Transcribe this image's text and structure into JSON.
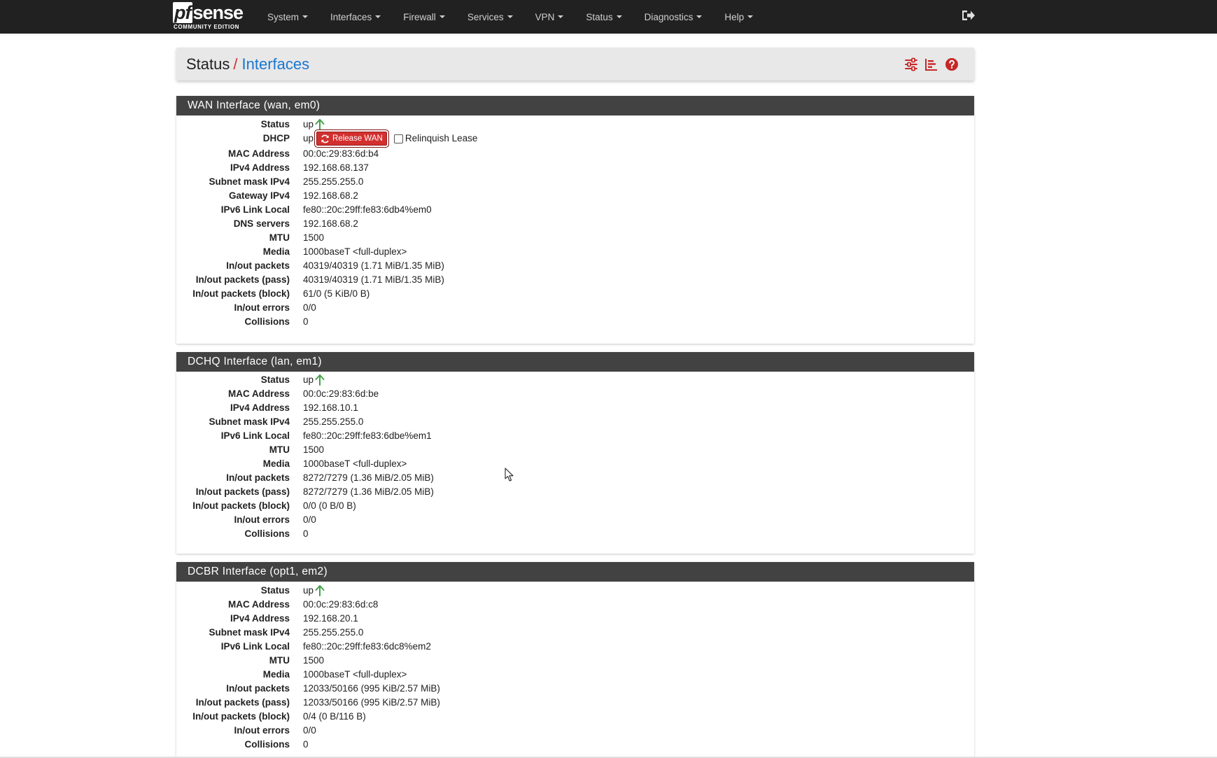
{
  "navbar": {
    "logo_main": "sense",
    "logo_pf": "pf",
    "logo_sub": "COMMUNITY EDITION",
    "menu": [
      {
        "label": "System"
      },
      {
        "label": "Interfaces"
      },
      {
        "label": "Firewall"
      },
      {
        "label": "Services"
      },
      {
        "label": "VPN"
      },
      {
        "label": "Status"
      },
      {
        "label": "Diagnostics"
      },
      {
        "label": "Help"
      }
    ],
    "logout_icon": "sign-out-icon"
  },
  "breadcrumb": {
    "first": "Status",
    "separator": "/",
    "last": "Interfaces",
    "icons": [
      "sliders-icon",
      "bar-chart-icon",
      "help-circle-icon"
    ]
  },
  "colors": {
    "navbar_bg": "#212121",
    "panel_head_bg": "#424242",
    "accent_red": "#d32f2f",
    "link_blue": "#1976d2",
    "status_up_green": "#43a047"
  },
  "interfaces": [
    {
      "title": "WAN Interface (wan, em0)",
      "status": "up",
      "dhcp": {
        "label": "DHCP",
        "value": "up",
        "button": "Release WAN",
        "checkbox_label": "Relinquish Lease",
        "checked": false
      },
      "rows": [
        {
          "label": "MAC Address",
          "value": "00:0c:29:83:6d:b4"
        },
        {
          "label": "IPv4 Address",
          "value": "192.168.68.137"
        },
        {
          "label": "Subnet mask IPv4",
          "value": "255.255.255.0"
        },
        {
          "label": "Gateway IPv4",
          "value": "192.168.68.2"
        },
        {
          "label": "IPv6 Link Local",
          "value": "fe80::20c:29ff:fe83:6db4%em0"
        },
        {
          "label": "DNS servers",
          "value": "192.168.68.2"
        },
        {
          "label": "MTU",
          "value": "1500"
        },
        {
          "label": "Media",
          "value": "1000baseT <full-duplex>"
        },
        {
          "label": "In/out packets",
          "value": "40319/40319 (1.71 MiB/1.35 MiB)"
        },
        {
          "label": "In/out packets (pass)",
          "value": "40319/40319 (1.71 MiB/1.35 MiB)"
        },
        {
          "label": "In/out packets (block)",
          "value": "61/0 (5 KiB/0 B)"
        },
        {
          "label": "In/out errors",
          "value": "0/0"
        },
        {
          "label": "Collisions",
          "value": "0"
        }
      ]
    },
    {
      "title": "DCHQ Interface (lan, em1)",
      "status": "up",
      "rows": [
        {
          "label": "MAC Address",
          "value": "00:0c:29:83:6d:be"
        },
        {
          "label": "IPv4 Address",
          "value": "192.168.10.1"
        },
        {
          "label": "Subnet mask IPv4",
          "value": "255.255.255.0"
        },
        {
          "label": "IPv6 Link Local",
          "value": "fe80::20c:29ff:fe83:6dbe%em1"
        },
        {
          "label": "MTU",
          "value": "1500"
        },
        {
          "label": "Media",
          "value": "1000baseT <full-duplex>"
        },
        {
          "label": "In/out packets",
          "value": "8272/7279 (1.36 MiB/2.05 MiB)"
        },
        {
          "label": "In/out packets (pass)",
          "value": "8272/7279 (1.36 MiB/2.05 MiB)"
        },
        {
          "label": "In/out packets (block)",
          "value": "0/0 (0 B/0 B)"
        },
        {
          "label": "In/out errors",
          "value": "0/0"
        },
        {
          "label": "Collisions",
          "value": "0"
        }
      ]
    },
    {
      "title": "DCBR Interface (opt1, em2)",
      "status": "up",
      "rows": [
        {
          "label": "MAC Address",
          "value": "00:0c:29:83:6d:c8"
        },
        {
          "label": "IPv4 Address",
          "value": "192.168.20.1"
        },
        {
          "label": "Subnet mask IPv4",
          "value": "255.255.255.0"
        },
        {
          "label": "IPv6 Link Local",
          "value": "fe80::20c:29ff:fe83:6dc8%em2"
        },
        {
          "label": "MTU",
          "value": "1500"
        },
        {
          "label": "Media",
          "value": "1000baseT <full-duplex>"
        },
        {
          "label": "In/out packets",
          "value": "12033/50166 (995 KiB/2.57 MiB)"
        },
        {
          "label": "In/out packets (pass)",
          "value": "12033/50166 (995 KiB/2.57 MiB)"
        },
        {
          "label": "In/out packets (block)",
          "value": "0/4 (0 B/116 B)"
        },
        {
          "label": "In/out errors",
          "value": "0/0"
        },
        {
          "label": "Collisions",
          "value": "0"
        }
      ]
    }
  ],
  "labels": {
    "status": "Status"
  }
}
